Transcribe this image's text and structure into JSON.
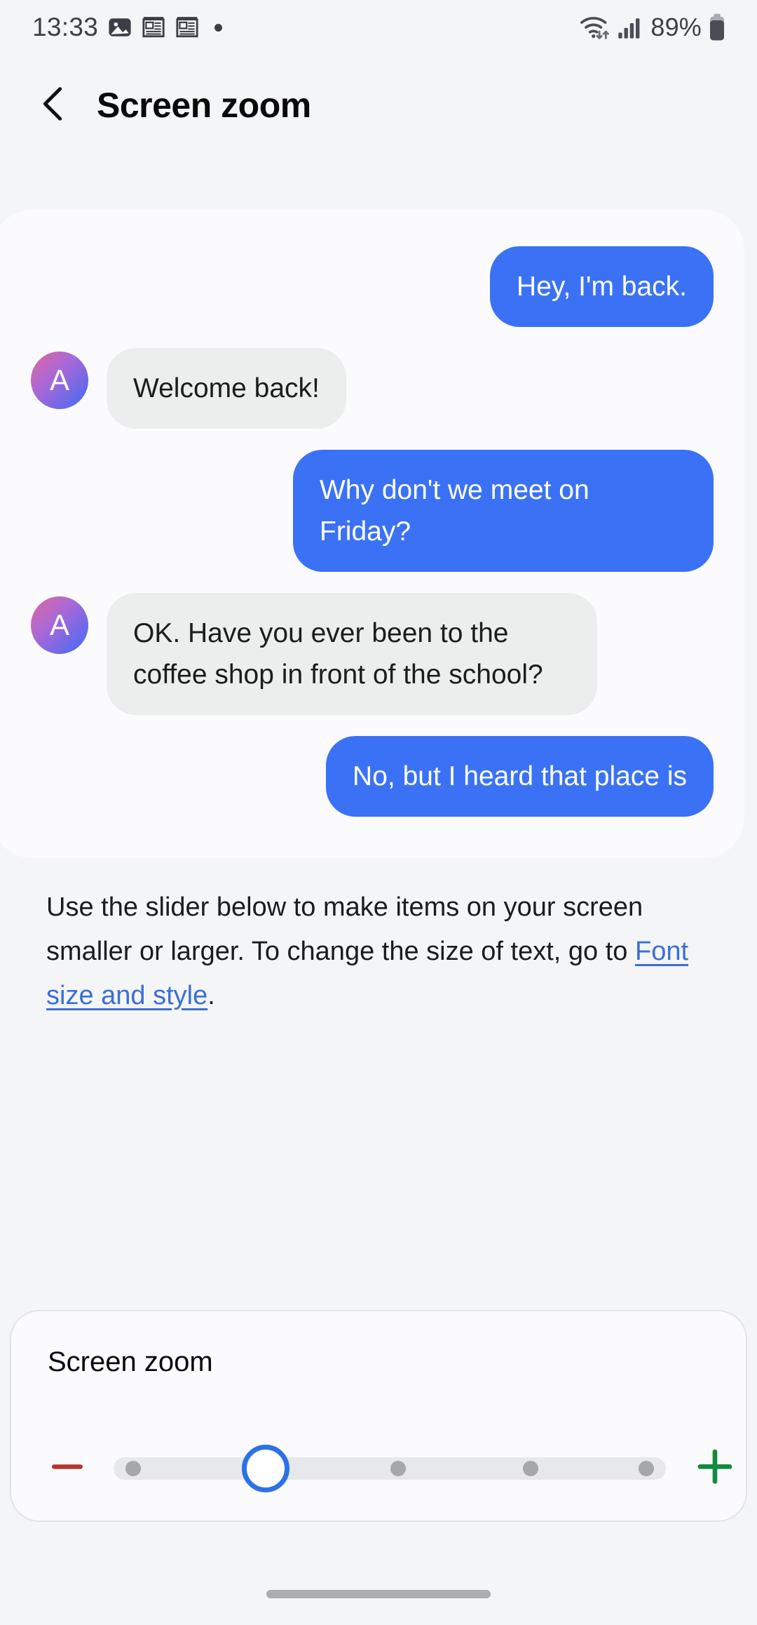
{
  "status_bar": {
    "time": "13:33",
    "left_icons": [
      "image-icon",
      "news-icon",
      "news-icon",
      "dot-icon"
    ],
    "battery_percent": "89%",
    "right_icons": [
      "wifi-icon",
      "signal-icon",
      "battery-icon"
    ]
  },
  "header": {
    "back_label": "Back",
    "title": "Screen zoom"
  },
  "preview": {
    "messages": [
      {
        "type": "sent",
        "text": "Hey, I'm back.",
        "avatar": null
      },
      {
        "type": "received",
        "text": "Welcome back!",
        "avatar": "A"
      },
      {
        "type": "sent",
        "text": "Why don't we meet on Friday?",
        "avatar": null
      },
      {
        "type": "received",
        "text": "OK. Have you ever been to the coffee shop in front of the school?",
        "avatar": "A"
      },
      {
        "type": "sent",
        "text": "No, but I heard that place is",
        "avatar": null
      }
    ]
  },
  "description": {
    "text_before": "Use the slider below to make items on your screen smaller or larger. To change the size of text, go to ",
    "link_text": "Font size and style",
    "text_after": "."
  },
  "slider_section": {
    "title": "Screen zoom",
    "decrease_label": "−",
    "increase_label": "+",
    "steps": 5,
    "current_step": 2,
    "tick_positions": [
      0,
      1,
      2,
      3,
      4
    ]
  },
  "colors": {
    "accent_blue": "#3b72f5",
    "link_blue": "#3b6fd4",
    "thumb_blue": "#2b72e8",
    "minus_red": "#b5352b",
    "plus_green": "#138a42",
    "received_bubble": "#eceded",
    "page_bg": "#f4f5f7",
    "card_bg": "#fbfbfd"
  },
  "navigation": {
    "home_indicator": "home-indicator"
  }
}
